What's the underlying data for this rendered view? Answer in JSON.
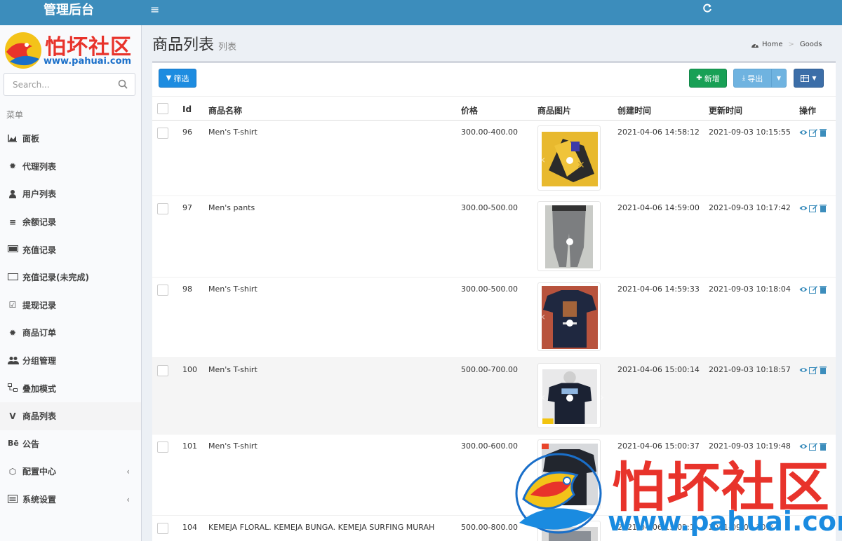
{
  "brand": "管理后台",
  "logo": {
    "text": "怕坏社区",
    "url": "www.pahuai.com"
  },
  "search": {
    "placeholder": "Search..."
  },
  "menu_header": "菜单",
  "menu": [
    {
      "label": "面板",
      "icon": "area-chart-icon"
    },
    {
      "label": "代理列表",
      "icon": "gear-icon"
    },
    {
      "label": "用户列表",
      "icon": "user-icon"
    },
    {
      "label": "余额记录",
      "icon": "list-icon"
    },
    {
      "label": "充值记录",
      "icon": "battery-full-icon"
    },
    {
      "label": "充值记录(未完成)",
      "icon": "battery-empty-icon"
    },
    {
      "label": "提现记录",
      "icon": "check-square-icon"
    },
    {
      "label": "商品订单",
      "icon": "gear-icon"
    },
    {
      "label": "分组管理",
      "icon": "users-icon"
    },
    {
      "label": "叠加模式",
      "icon": "sitemap-icon"
    },
    {
      "label": "商品列表",
      "icon": "vine-icon"
    },
    {
      "label": "公告",
      "icon": "behance-icon"
    },
    {
      "label": "配置中心",
      "icon": "cog-icon",
      "expandable": true
    },
    {
      "label": "系统设置",
      "icon": "list-alt-icon",
      "expandable": true
    }
  ],
  "active_menu": "商品列表",
  "page": {
    "title": "商品列表",
    "subtitle": "列表"
  },
  "breadcrumb": [
    "Home",
    "Goods"
  ],
  "toolbar": {
    "filter": "筛选",
    "add": "新增",
    "export": "导出"
  },
  "columns": [
    "Id",
    "商品名称",
    "价格",
    "商品图片",
    "创建时间",
    "更新时间",
    "操作"
  ],
  "rows": [
    {
      "id": "96",
      "name": "Men's T-shirt",
      "price": "300.00-400.00",
      "created": "2021-04-06 14:58:12",
      "updated": "2021-09-03 10:15:55",
      "image": "yellow-shirt"
    },
    {
      "id": "97",
      "name": "Men's pants",
      "price": "300.00-500.00",
      "created": "2021-04-06 14:59:00",
      "updated": "2021-09-03 10:17:42",
      "image": "grey-pants"
    },
    {
      "id": "98",
      "name": "Men's T-shirt",
      "price": "300.00-500.00",
      "created": "2021-04-06 14:59:33",
      "updated": "2021-09-03 10:18:04",
      "image": "navy-shirt"
    },
    {
      "id": "100",
      "name": "Men's T-shirt",
      "price": "500.00-700.00",
      "created": "2021-04-06 15:00:14",
      "updated": "2021-09-03 10:18:57",
      "image": "mannequin-shirt"
    },
    {
      "id": "101",
      "name": "Men's T-shirt",
      "price": "300.00-600.00",
      "created": "2021-04-06 15:00:37",
      "updated": "2021-09-03 10:19:48",
      "image": "dark-shirt"
    },
    {
      "id": "104",
      "name": "KEMEJA FLORAL. KEMEJA BUNGA. KEMEJA SURFING MURAH",
      "price": "500.00-800.00",
      "created": "2021-04-06 15:02:1",
      "updated": "2021-09-03 10:2",
      "image": "floral-shirt"
    }
  ],
  "highlighted_row": "100",
  "watermark": {
    "text": "怕坏社区",
    "url": "www.pahuai.com"
  },
  "colors": {
    "header": "#3c8dbc",
    "add": "#18a055",
    "filter": "#1d8ce0",
    "export": "#6fb3e0",
    "columns": "#3c6ea8",
    "logo_red": "#e8332b",
    "logo_blue": "#1a6fc9"
  }
}
